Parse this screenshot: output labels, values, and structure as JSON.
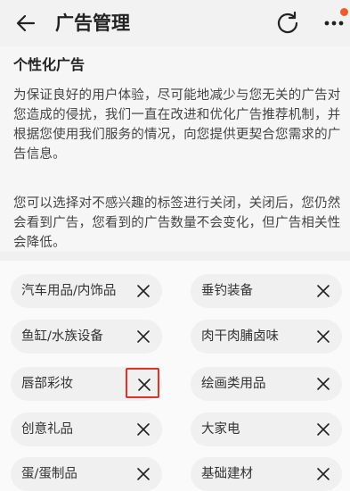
{
  "header": {
    "title": "广告管理",
    "icons": [
      "back-arrow-icon",
      "refresh-icon",
      "more-icon"
    ],
    "notification_dot_color": "#f05b2b"
  },
  "section": {
    "title": "个性化广告",
    "paragraph1": "为保证良好的用户体验，尽可能地减少与您无关的广告对您造成的侵扰，我们一直在改进和优化广告推荐机制，并根据您使用我们服务的情况，向您提供更契合您需求的广告信息。",
    "paragraph2": "您可以选择对不感兴趣的标签进行关闭，关闭后，您仍然会看到广告，您看到的广告数量不会变化，但广告相关性会降低。"
  },
  "tags": [
    {
      "label": "汽车用品/内饰品"
    },
    {
      "label": "垂钓装备"
    },
    {
      "label": "鱼缸/水族设备"
    },
    {
      "label": "肉干肉脯卤味"
    },
    {
      "label": "唇部彩妆"
    },
    {
      "label": "绘画类用品"
    },
    {
      "label": "创意礼品"
    },
    {
      "label": "大家电"
    },
    {
      "label": "蛋/蛋制品"
    },
    {
      "label": "基础建材"
    }
  ],
  "highlight_color": "#e0312b"
}
